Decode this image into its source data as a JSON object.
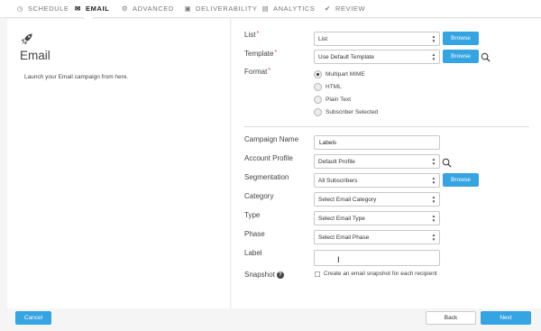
{
  "tabs": [
    {
      "label": "SCHEDULE",
      "icon": "clock-icon",
      "glyph": "◷"
    },
    {
      "label": "EMAIL",
      "icon": "envelope-icon",
      "glyph": "✉"
    },
    {
      "label": "ADVANCED",
      "icon": "gears-icon",
      "glyph": "⚙"
    },
    {
      "label": "DELIVERABILITY",
      "icon": "inbox-icon",
      "glyph": "▣"
    },
    {
      "label": "ANALYTICS",
      "icon": "chart-icon",
      "glyph": "▤"
    },
    {
      "label": "REVIEW",
      "icon": "check-icon",
      "glyph": "✔"
    }
  ],
  "active_tab": "EMAIL",
  "left": {
    "title": "Email",
    "description": "Launch your Email campaign from here.",
    "icon": "rocket-icon"
  },
  "form": {
    "list": {
      "label": "List",
      "required": "*",
      "value": "List",
      "browse": "Browse"
    },
    "template": {
      "label": "Template",
      "required": "*",
      "value": "Use Default Template",
      "browse": "Browse"
    },
    "format": {
      "label": "Format",
      "required": "*",
      "options": [
        "Multipart MIME",
        "HTML",
        "Plain Text",
        "Subscriber Selected"
      ],
      "selected": "Multipart MIME"
    },
    "campaign_name": {
      "label": "Campaign Name",
      "value": "Labels"
    },
    "account_profile": {
      "label": "Account Profile",
      "value": "Default Profile"
    },
    "segmentation": {
      "label": "Segmentation",
      "value": "All Subscribers",
      "browse": "Browse"
    },
    "category": {
      "label": "Category",
      "value": "Select Email Category"
    },
    "type": {
      "label": "Type",
      "value": "Select Email Type"
    },
    "phase": {
      "label": "Phase",
      "value": "Select Email Phase"
    },
    "label": {
      "label": "Label",
      "value": ""
    },
    "snapshot": {
      "label": "Snapshot",
      "help": "?",
      "checkbox_label": "Create an email snapshot for each recipient",
      "checked": false
    }
  },
  "footer": {
    "cancel": "Cancel",
    "back": "Back",
    "next": "Next"
  },
  "colors": {
    "accent": "#35a4e2",
    "required": "#dd3333",
    "panel": "#ffffff",
    "background": "#f5f5f5"
  }
}
